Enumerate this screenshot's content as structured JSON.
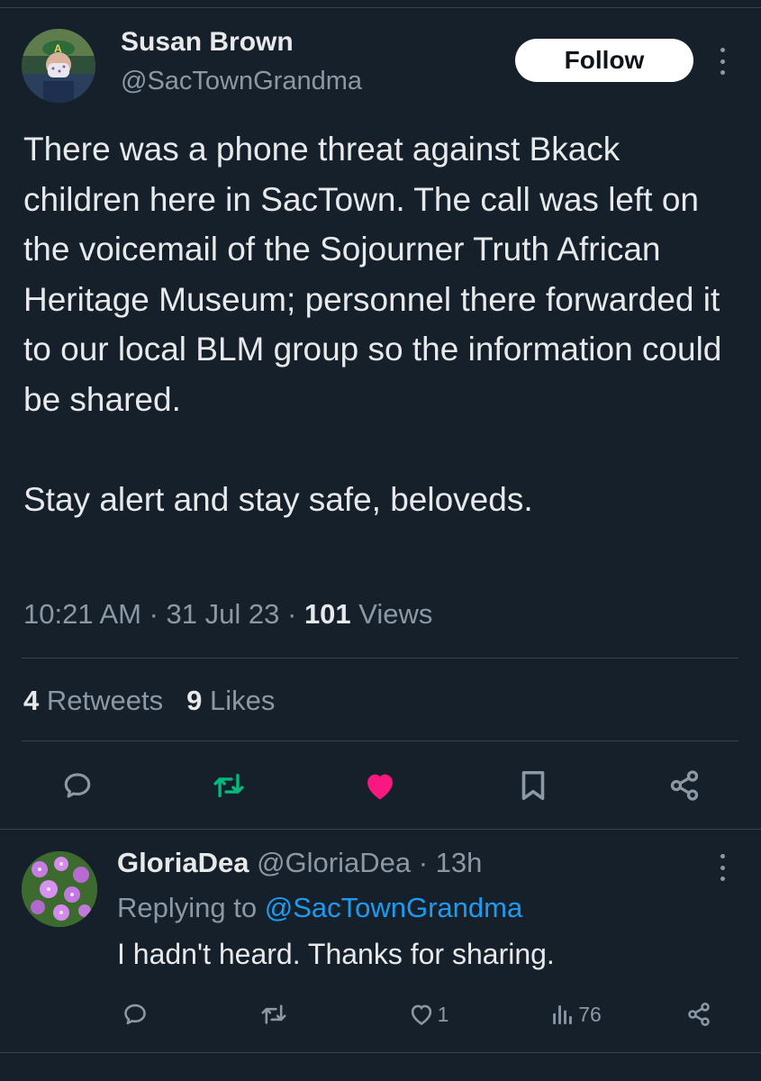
{
  "tweet": {
    "author_name": "Susan Brown",
    "author_handle": "@SacTownGrandma",
    "follow_label": "Follow",
    "text": "There was a phone threat against Bkack children here in SacTown. The call was left on the voicemail of the Sojourner Truth African Heritage Museum; personnel there forwarded it to our local BLM group so the information could be shared.\n\nStay alert and stay safe, beloveds.",
    "time": "10:21 AM",
    "date": "31 Jul 23",
    "views_count": "101",
    "views_label": "Views",
    "retweets_count": "4",
    "retweets_label": "Retweets",
    "likes_count": "9",
    "likes_label": "Likes"
  },
  "actions": {
    "reply_icon": "reply-icon",
    "retweet_icon": "retweet-icon",
    "like_icon": "heart-icon",
    "bookmark_icon": "bookmark-icon",
    "share_icon": "share-icon",
    "retweet_color": "#00ba7c",
    "like_color": "#f91880"
  },
  "reply": {
    "author_name": "GloriaDea",
    "author_handle": "@GloriaDea",
    "age": "13h",
    "replying_to_label": "Replying to",
    "replying_to_handle": "@SacTownGrandma",
    "text": "I hadn't heard. Thanks for sharing.",
    "likes_count": "1",
    "views_count": "76"
  },
  "colors": {
    "background": "#15202b",
    "link": "#1d9bf0",
    "secondary_text": "#8b98a5"
  }
}
